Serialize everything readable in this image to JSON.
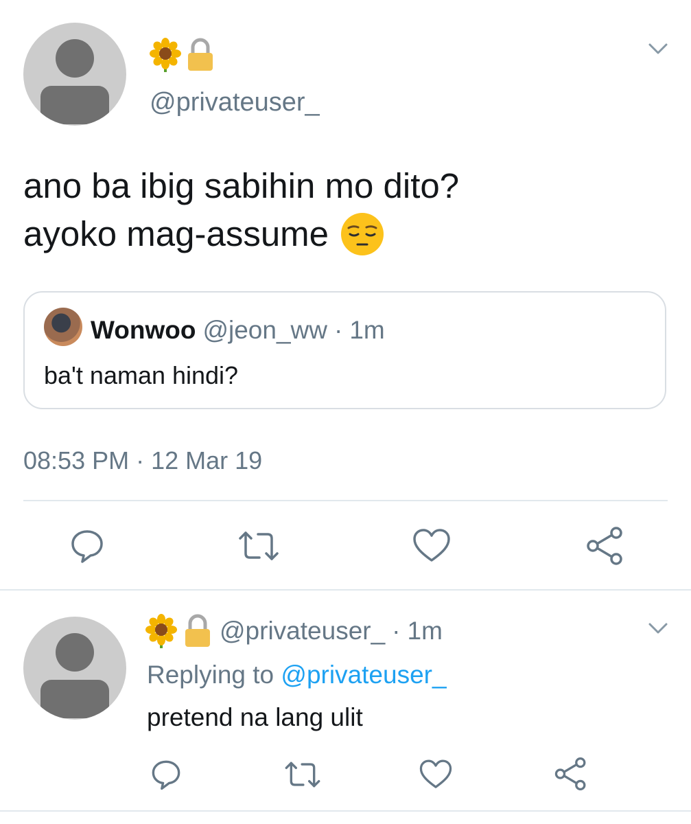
{
  "main_tweet": {
    "handle": "@privateuser_",
    "text_line1": "ano ba ibig sabihin mo dito?",
    "text_line2": "ayoko mag-assume",
    "timestamp": "08:53 PM · 12 Mar 19",
    "name_emojis": [
      "sunflower-icon",
      "lock-icon"
    ],
    "text_emoji": "pensive-face-icon"
  },
  "quoted_tweet": {
    "name": "Wonwoo",
    "handle": "@jeon_ww",
    "separator": "·",
    "time": "1m",
    "text": "ba't naman hindi?"
  },
  "reply": {
    "handle": "@privateuser_",
    "separator": "·",
    "time": "1m",
    "replying_prefix": "Replying to",
    "replying_handle": "@privateuser_",
    "text": "pretend na lang ulit"
  },
  "actions": [
    "reply-icon",
    "retweet-icon",
    "like-icon",
    "share-icon"
  ],
  "colors": {
    "text": "#14171a",
    "secondary": "#657786",
    "link": "#1da1f2",
    "border": "#e1e8ed"
  }
}
